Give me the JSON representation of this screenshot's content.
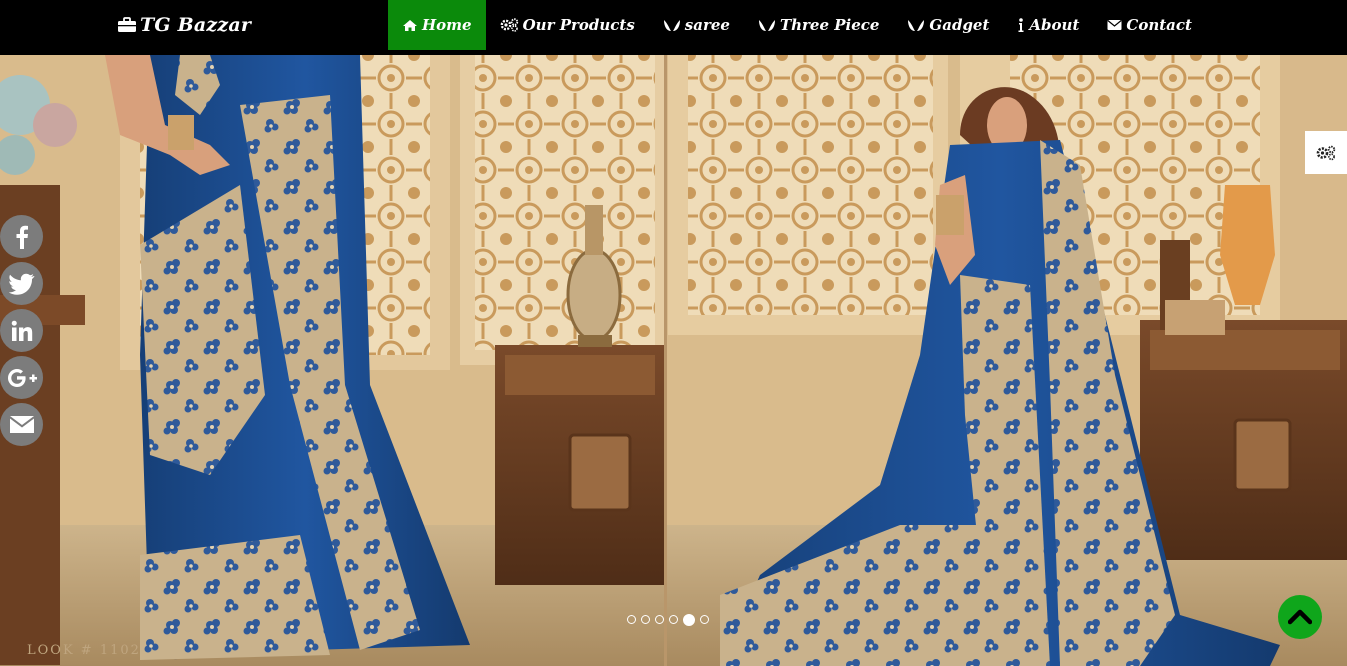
{
  "brand": {
    "name": "TG Bazzar",
    "icon": "briefcase-icon"
  },
  "nav": {
    "items": [
      {
        "label": "Home",
        "icon": "home-icon",
        "active": true
      },
      {
        "label": "Our Products",
        "icon": "gears-icon",
        "active": false
      },
      {
        "label": "saree",
        "icon": "leaf-pair-icon",
        "active": false
      },
      {
        "label": "Three Piece",
        "icon": "leaf-pair-icon",
        "active": false
      },
      {
        "label": "Gadget",
        "icon": "leaf-pair-icon",
        "active": false
      },
      {
        "label": "About",
        "icon": "info-icon",
        "active": false
      },
      {
        "label": "Contact",
        "icon": "envelope-icon",
        "active": false
      }
    ]
  },
  "hero": {
    "look_label": "LOOK # 1102",
    "slides_count": 6,
    "active_slide": 5
  },
  "social": [
    {
      "name": "facebook"
    },
    {
      "name": "twitter"
    },
    {
      "name": "linkedin"
    },
    {
      "name": "google-plus"
    },
    {
      "name": "email"
    }
  ],
  "colors": {
    "navbar_bg": "#000000",
    "active_nav_bg": "#0b8a0b",
    "social_bg": "#7c7c7c",
    "scroll_top_bg": "#0fa61b",
    "saree_blue": "#1c4d8c"
  }
}
